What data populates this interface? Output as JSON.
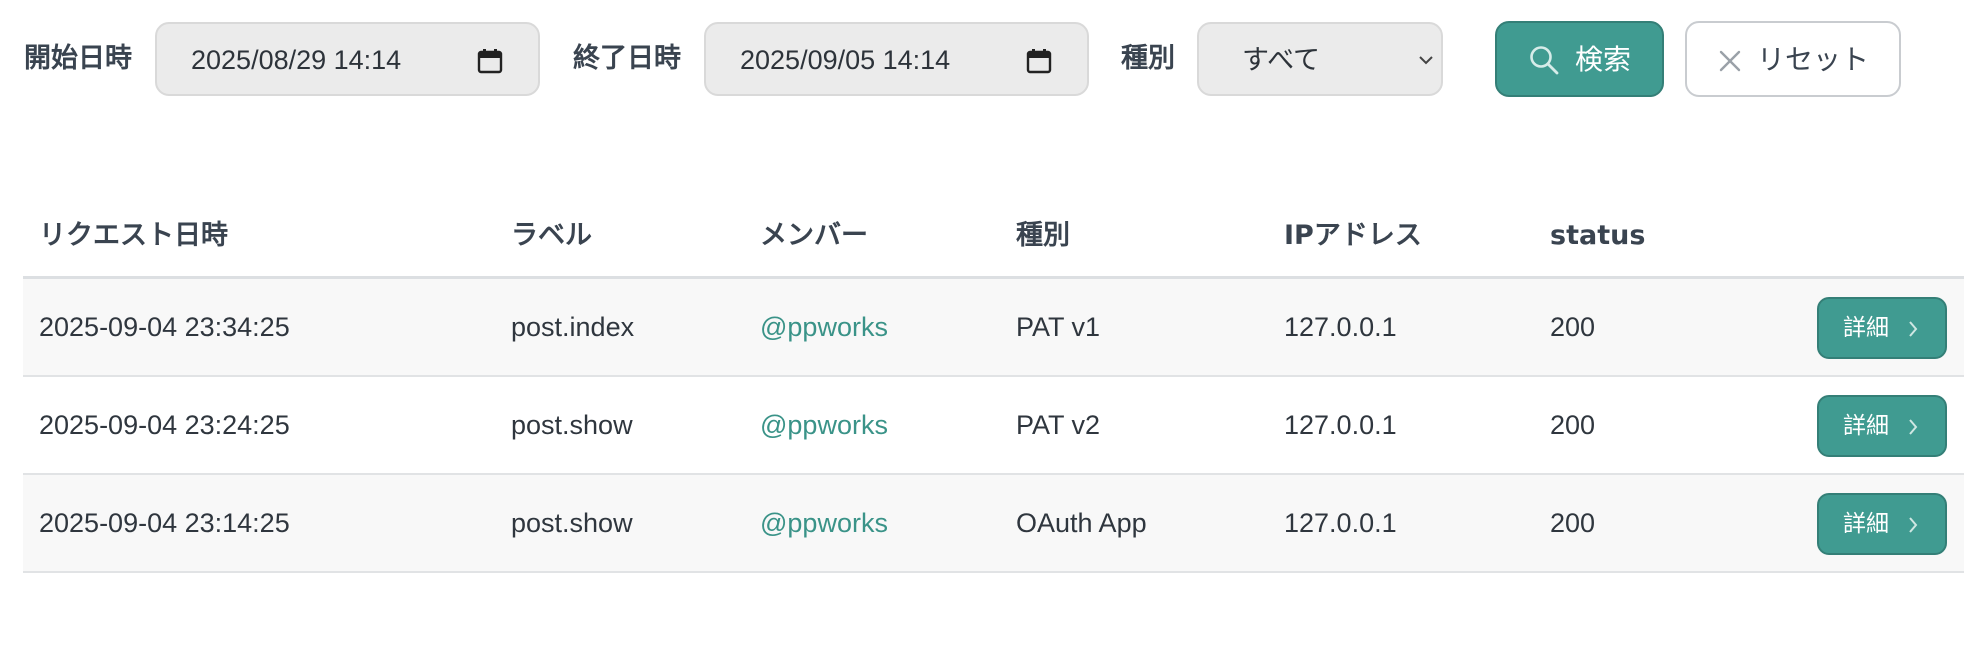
{
  "filters": {
    "start": {
      "label": "開始日時",
      "value": "2025/08/29  14:14",
      "icon": "calendar-icon"
    },
    "end": {
      "label": "終了日時",
      "value": "2025/09/05  14:14",
      "icon": "calendar-icon"
    },
    "type": {
      "label": "種別",
      "value": "すべて",
      "icon": "chevron-down-icon"
    },
    "search_button": {
      "label": "検索",
      "icon": "search-icon"
    },
    "reset_button": {
      "label": "リセット",
      "icon": "close-icon"
    }
  },
  "colors": {
    "accent": "#409b91",
    "link": "#3a9388",
    "text": "#3a4450"
  },
  "table": {
    "headers": [
      "リクエスト日時",
      "ラベル",
      "メンバー",
      "種別",
      "IPアドレス",
      "status"
    ],
    "rows": [
      {
        "datetime": "2025-09-04 23:34:25",
        "label": "post.index",
        "member": "@ppworks",
        "type": "PAT v1",
        "ip": "127.0.0.1",
        "status": "200",
        "action": "詳細"
      },
      {
        "datetime": "2025-09-04 23:24:25",
        "label": "post.show",
        "member": "@ppworks",
        "type": "PAT v2",
        "ip": "127.0.0.1",
        "status": "200",
        "action": "詳細"
      },
      {
        "datetime": "2025-09-04 23:14:25",
        "label": "post.show",
        "member": "@ppworks",
        "type": "OAuth App",
        "ip": "127.0.0.1",
        "status": "200",
        "action": "詳細"
      }
    ]
  }
}
